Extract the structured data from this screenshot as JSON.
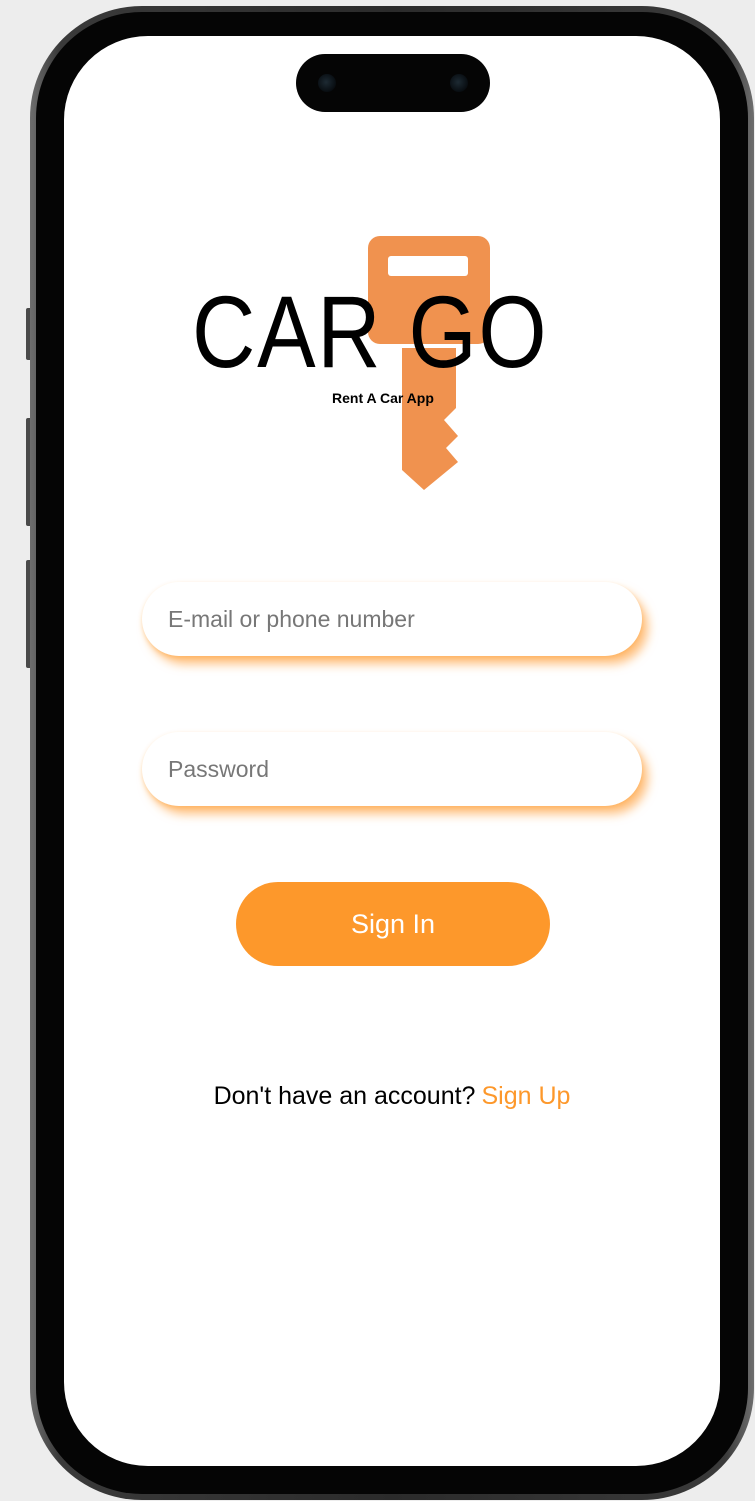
{
  "brand": {
    "name": "CAR GO",
    "tagline": "Rent A Car App",
    "logo_icon": "key-icon",
    "logo_color": "#f0924f"
  },
  "login": {
    "email_placeholder": "E-mail or phone number",
    "password_placeholder": "Password",
    "signin_label": "Sign In"
  },
  "footer": {
    "prompt": "Don't have an account?",
    "signup_label": "Sign Up"
  },
  "theme": {
    "accent": "#fd982b",
    "background": "#ffffff",
    "text": "#000000"
  }
}
